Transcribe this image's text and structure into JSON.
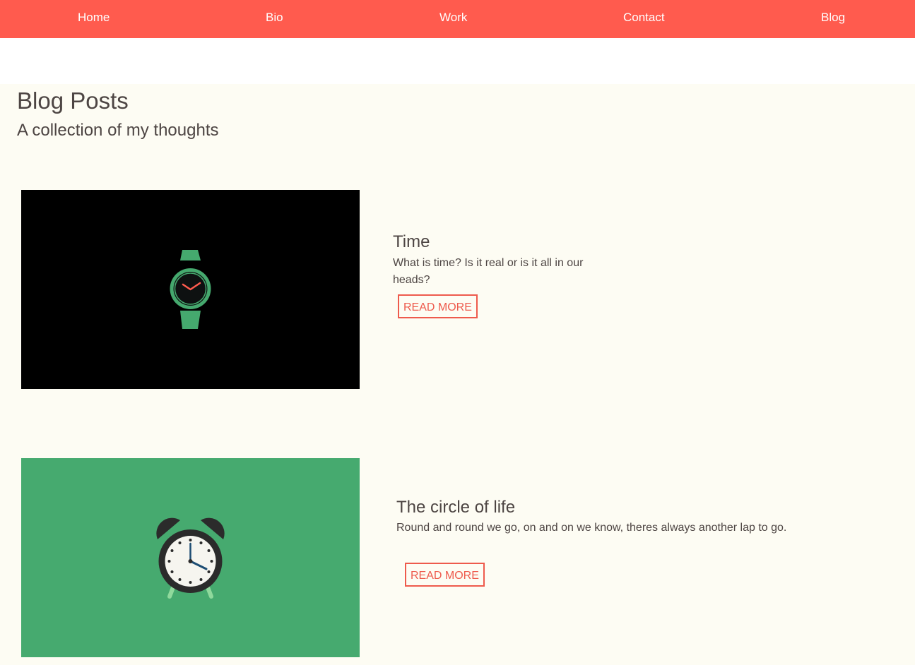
{
  "nav": {
    "items": [
      {
        "label": "Home"
      },
      {
        "label": "Bio"
      },
      {
        "label": "Work"
      },
      {
        "label": "Contact"
      },
      {
        "label": "Blog"
      }
    ]
  },
  "blog": {
    "title": "Blog Posts",
    "subtitle": "A collection of my thoughts",
    "posts": [
      {
        "title": "Time",
        "excerpt": "What is time? Is it real or is it all in our heads?",
        "button_label": "READ MORE",
        "image_icon": "wristwatch-icon"
      },
      {
        "title": "The circle of life",
        "excerpt": "Round and round we go, on and on we know, theres always another lap to go.",
        "button_label": "READ MORE",
        "image_icon": "alarm-clock-icon"
      }
    ]
  },
  "colors": {
    "accent": "#ff5b4e",
    "button_border": "#ee5a4c",
    "section_bg": "#fdfcf3",
    "text": "#4d4543",
    "watch_green": "#45a96e",
    "image1_bg": "#000000",
    "image2_bg": "#46aa6f"
  }
}
